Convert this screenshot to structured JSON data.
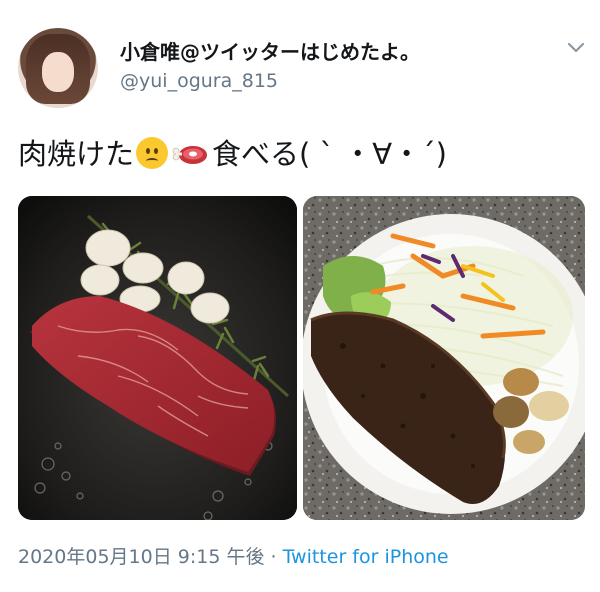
{
  "tweet": {
    "display_name": "小倉唯@ツイッターはじめたよ。",
    "handle": "@yui_ogura_815",
    "text_before": "肉焼けた",
    "text_after": "食べる( ` ・∀・´)",
    "emoji": [
      "frowning-face",
      "meat-on-bone"
    ],
    "timestamp": "2020年05月10日 9:15 午後",
    "separator": " · ",
    "source": "Twitter for iPhone"
  },
  "colors": {
    "name": "#14171a",
    "secondary": "#657786",
    "link": "#1b95e0"
  },
  "icons": {
    "menu": "chevron-down-icon"
  },
  "images": [
    {
      "name": "steak-in-pan-photo"
    },
    {
      "name": "steak-with-salad-plate-photo"
    }
  ]
}
